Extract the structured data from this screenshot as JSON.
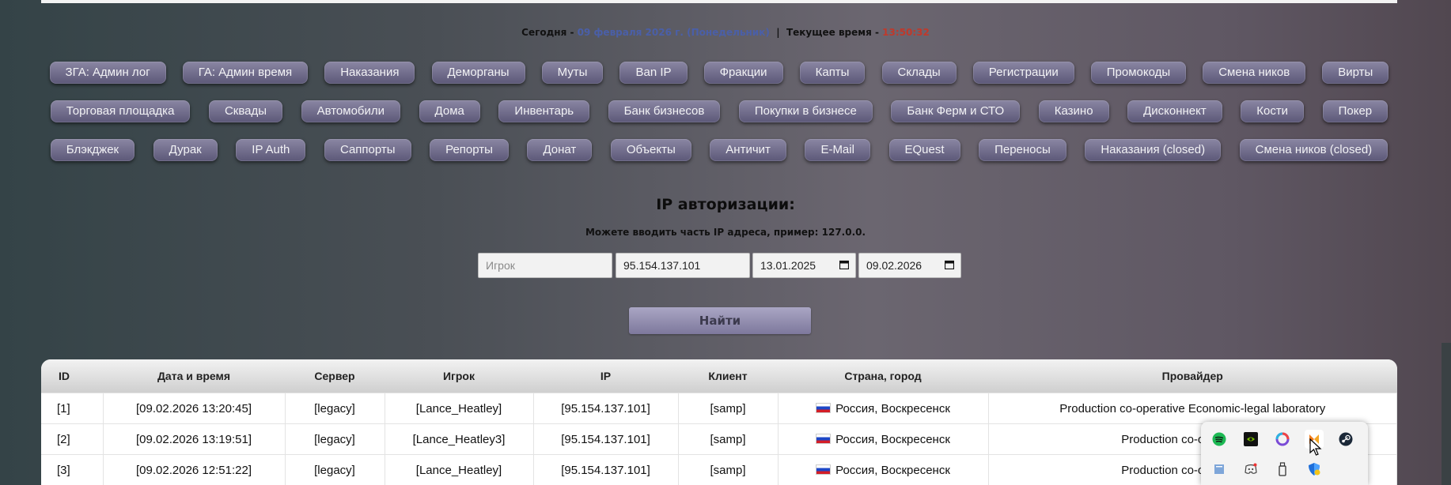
{
  "header": {
    "today_label": "Сегодня -",
    "date_text": "09 февраля 2026 г. (Понедельник)",
    "separator": "|",
    "time_label": "Текущее время -",
    "time_text": "13:50:32"
  },
  "nav": {
    "row1": [
      "ЗГА: Админ лог",
      "ГА: Админ время",
      "Наказания",
      "Деморганы",
      "Муты",
      "Ban IP",
      "Фракции",
      "Капты",
      "Склады",
      "Регистрации",
      "Промокоды",
      "Смена ников",
      "Вирты"
    ],
    "row2": [
      "Торговая площадка",
      "Сквады",
      "Автомобили",
      "Дома",
      "Инвентарь",
      "Банк бизнесов",
      "Покупки в бизнесе",
      "Банк Ферм и СТО",
      "Казино",
      "Дисконнект",
      "Кости",
      "Покер"
    ],
    "row3": [
      "Блэкджек",
      "Дурак",
      "IP Auth",
      "Саппорты",
      "Репорты",
      "Донат",
      "Объекты",
      "Античит",
      "E-Mail",
      "EQuest",
      "Переносы",
      "Наказания (closed)",
      "Смена ников (closed)"
    ]
  },
  "search": {
    "title": "IP авторизации:",
    "hint": "Можете вводить часть IP адреса, пример: 127.0.0.",
    "player_placeholder": "Игрок",
    "ip_value": "95.154.137.101",
    "date_from": "13.01.2025",
    "date_to": "09.02.2026",
    "submit_label": "Найти"
  },
  "table": {
    "headers": {
      "id": "ID",
      "datetime": "Дата и время",
      "server": "Сервер",
      "player": "Игрок",
      "ip": "IP",
      "client": "Клиент",
      "location": "Страна, город",
      "provider": "Провайдер"
    },
    "rows": [
      {
        "id": "[1]",
        "datetime": "[09.02.2026 13:20:45]",
        "server": "[legacy]",
        "player": "[Lance_Heatley]",
        "ip": "[95.154.137.101]",
        "client": "[samp]",
        "location": "Россия, Воскресенск",
        "provider": "Production co-operative Economic-legal laboratory"
      },
      {
        "id": "[2]",
        "datetime": "[09.02.2026 13:19:51]",
        "server": "[legacy]",
        "player": "[Lance_Heatley3]",
        "ip": "[95.154.137.101]",
        "client": "[samp]",
        "location": "Россия, Воскресенск",
        "provider": "Production co-operative Ec"
      },
      {
        "id": "[3]",
        "datetime": "[09.02.2026 12:51:22]",
        "server": "[legacy]",
        "player": "[Lance_Heatley]",
        "ip": "[95.154.137.101]",
        "client": "[samp]",
        "location": "Россия, Воскресенск",
        "provider": "Production co-operative Ec"
      }
    ]
  },
  "tray": {
    "icons": [
      "spotify-icon",
      "nvidia-icon",
      "app-icon",
      "vpn-icon",
      "steam-icon",
      "notepad-icon",
      "discord-icon",
      "usb-icon",
      "defender-icon"
    ]
  }
}
